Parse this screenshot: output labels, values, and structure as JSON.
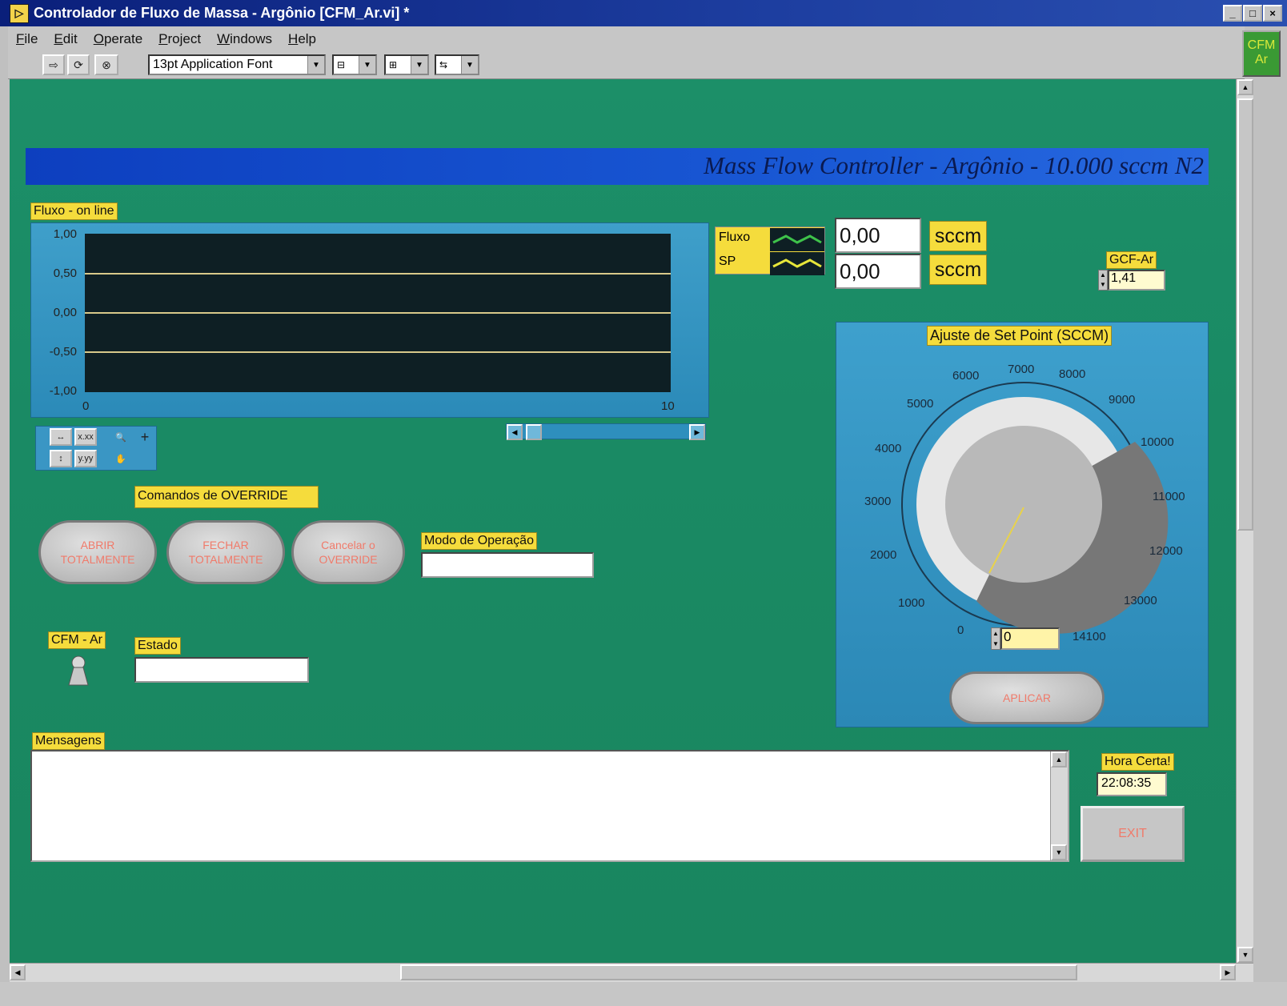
{
  "window": {
    "title": "Controlador de Fluxo de Massa - Argônio [CFM_Ar.vi] *",
    "controls": [
      "_",
      "□",
      "×"
    ]
  },
  "menu": [
    "File",
    "Edit",
    "Operate",
    "Project",
    "Windows",
    "Help"
  ],
  "toolbar": {
    "font_select": "13pt Application Font",
    "corner_icon_line1": "CFM",
    "corner_icon_line2": "Ar"
  },
  "banner": {
    "title": "Mass Flow Controller - Argônio - 10.000 sccm N2"
  },
  "graph": {
    "label": "Fluxo - on line",
    "y_ticks": [
      "1,00",
      "0,50",
      "0,00",
      "-0,50",
      "-1,00"
    ],
    "x_ticks": [
      "0",
      "10"
    ],
    "palette": {
      "x_fmt": "x.xx",
      "y_fmt": "y.yy",
      "cursor": "+"
    }
  },
  "legend": {
    "fluxo": "Fluxo",
    "sp": "SP",
    "fluxo_value": "0,00",
    "sp_value": "0,00",
    "unit": "sccm"
  },
  "gcf": {
    "label": "GCF-Ar",
    "value": "1,41"
  },
  "setpoint": {
    "label": "Ajuste de Set Point (SCCM)",
    "ticks": [
      "0",
      "1000",
      "2000",
      "3000",
      "4000",
      "5000",
      "6000",
      "7000",
      "8000",
      "9000",
      "10000",
      "11000",
      "12000",
      "13000",
      "14100"
    ],
    "value": "0",
    "apply_label": "APLICAR"
  },
  "override": {
    "label": "Comandos de OVERRIDE",
    "open_line1": "ABRIR",
    "open_line2": "TOTALMENTE",
    "close_line1": "FECHAR",
    "close_line2": "TOTALMENTE",
    "cancel_line1": "Cancelar o",
    "cancel_line2": "OVERRIDE"
  },
  "mode": {
    "label": "Modo de Operação",
    "value": ""
  },
  "cfm_led": {
    "label": "CFM - Ar"
  },
  "estado": {
    "label": "Estado",
    "value": ""
  },
  "mensagens": {
    "label": "Mensagens",
    "value": ""
  },
  "clock": {
    "label": "Hora Certa!",
    "value": "22:08:35"
  },
  "exit": {
    "label": "EXIT"
  },
  "colors": {
    "panel": "#1a8a64",
    "label_bg": "#f5dc3c",
    "banner": "#1a5ad6",
    "button_text": "#f07a6a"
  }
}
